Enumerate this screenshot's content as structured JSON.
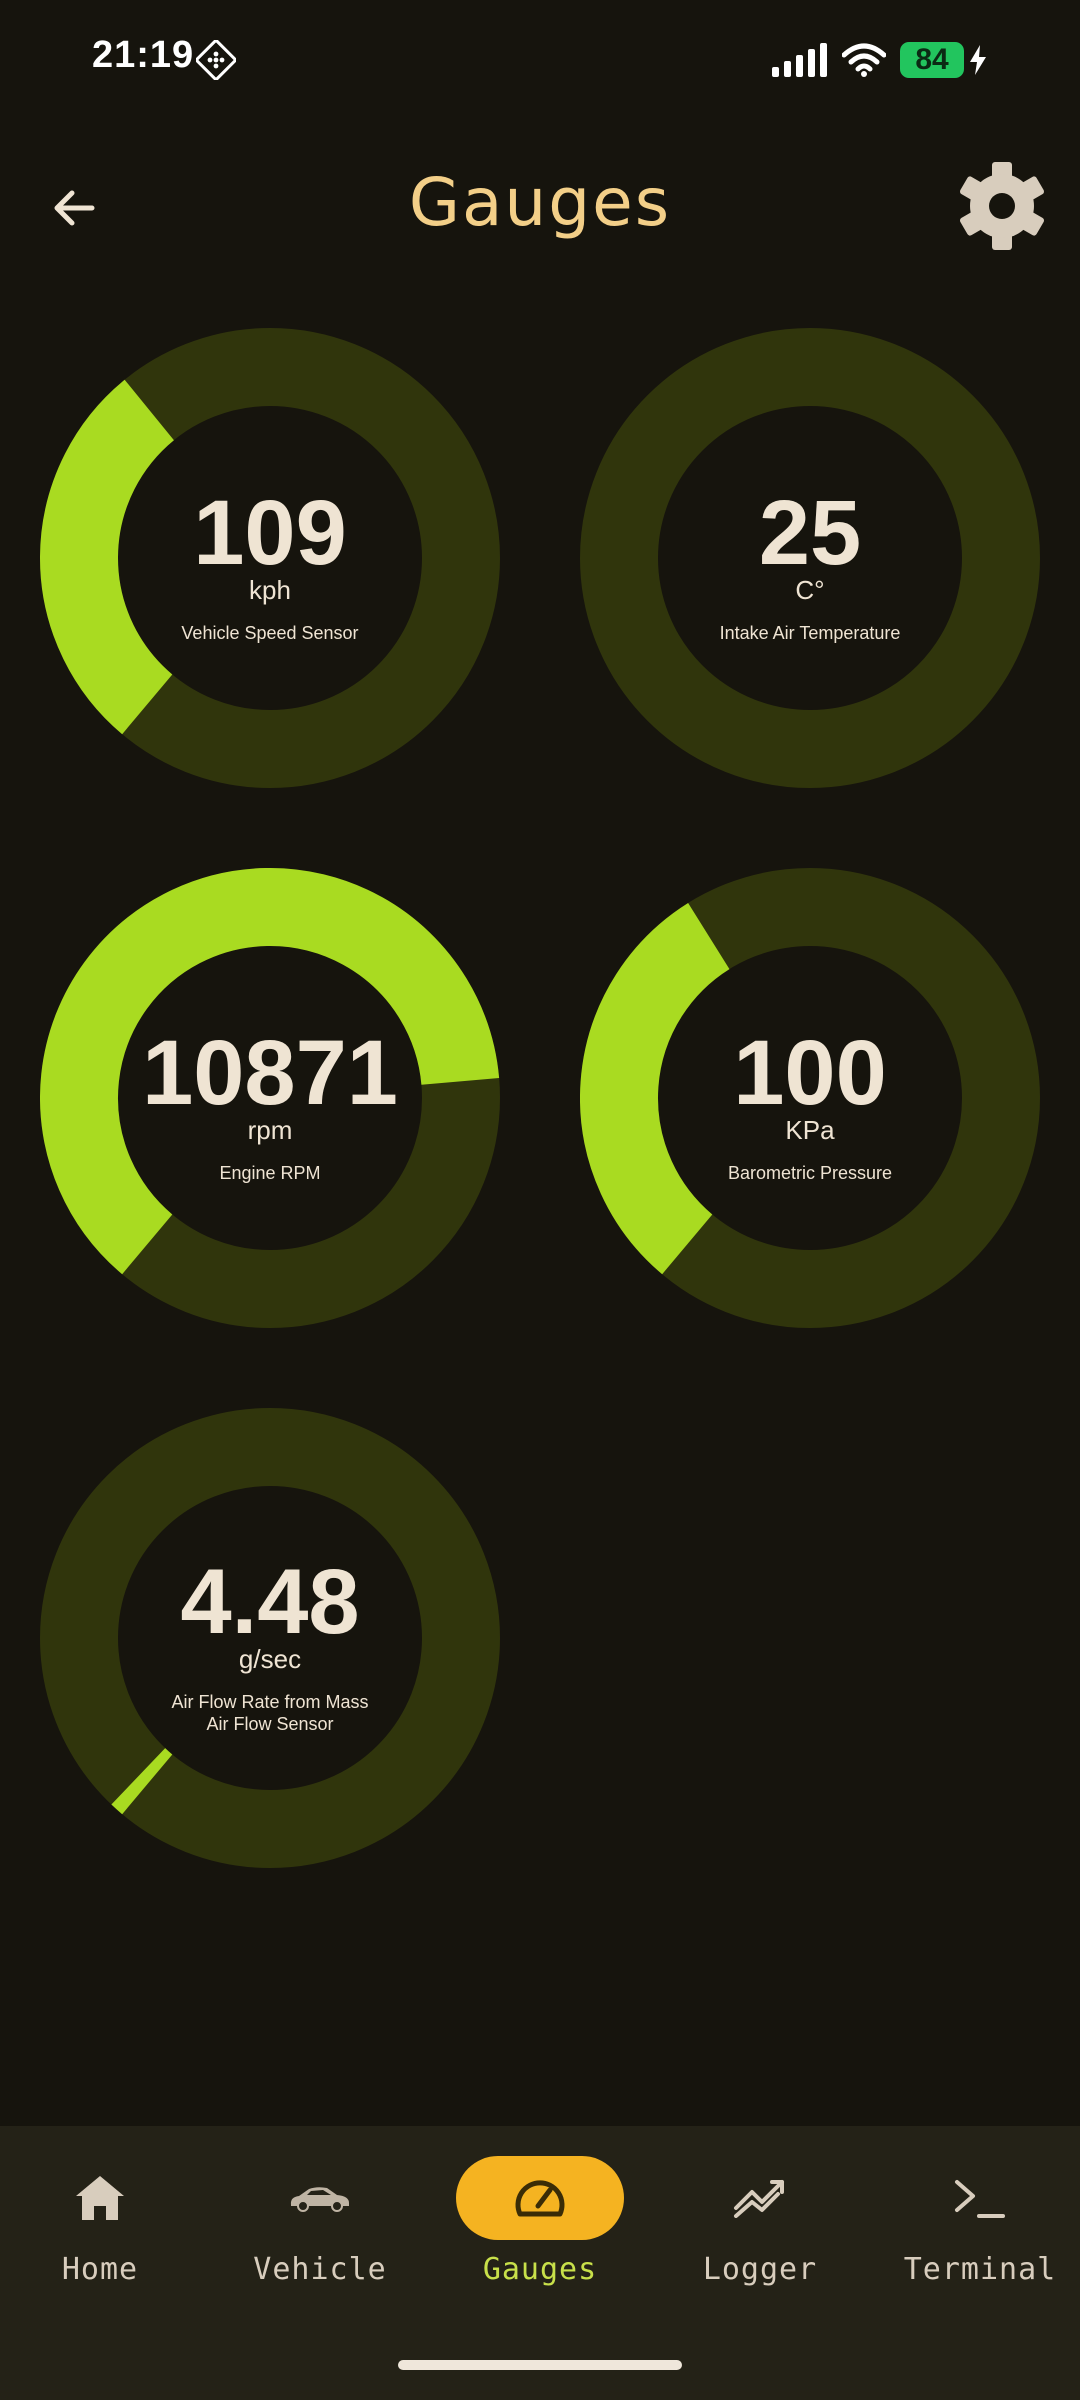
{
  "status_bar": {
    "time": "21:19",
    "battery_level": "84",
    "icons": [
      "app-grid-icon",
      "signal-icon",
      "wifi-icon",
      "battery-icon",
      "charging-bolt-icon"
    ]
  },
  "header": {
    "title": "Gauges",
    "back_icon": "arrow-left-icon",
    "settings_icon": "gear-icon"
  },
  "colors": {
    "background": "#16140d",
    "gauge_track": "#30350c",
    "gauge_fill": "#a9db21",
    "title": "#f3cf88",
    "active_tab": "#f5b321",
    "active_label": "#c8e04a"
  },
  "gauges": [
    {
      "value": "109",
      "unit": "kph",
      "label": "Vehicle Speed Sensor",
      "fill_fraction": 0.28
    },
    {
      "value": "25",
      "unit": "C°",
      "label": "Intake Air Temperature",
      "fill_fraction": 0.0
    },
    {
      "value": "10871",
      "unit": "rpm",
      "label": "Engine RPM",
      "fill_fraction": 0.625
    },
    {
      "value": "100",
      "unit": "KPa",
      "label": "Barometric Pressure",
      "fill_fraction": 0.3
    },
    {
      "value": "4.48",
      "unit": "g/sec",
      "label": "Air Flow Rate from Mass Air Flow Sensor",
      "fill_fraction": 0.01
    }
  ],
  "nav": {
    "items": [
      {
        "label": "Home",
        "icon": "home-icon",
        "active": false
      },
      {
        "label": "Vehicle",
        "icon": "car-icon",
        "active": false
      },
      {
        "label": "Gauges",
        "icon": "speedometer-icon",
        "active": true
      },
      {
        "label": "Logger",
        "icon": "chart-line-icon",
        "active": false
      },
      {
        "label": "Terminal",
        "icon": "terminal-icon",
        "active": false
      }
    ]
  }
}
